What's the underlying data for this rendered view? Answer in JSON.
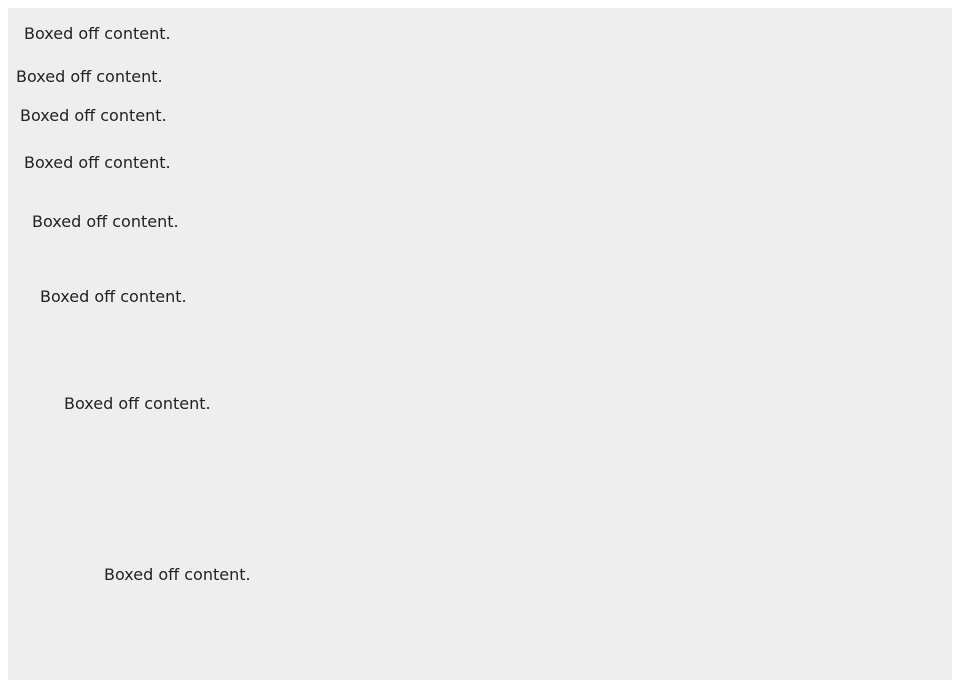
{
  "colors": {
    "panel_background": "#eeeeee",
    "text": "#222222"
  },
  "boxes": [
    {
      "text": "Boxed off content."
    },
    {
      "text": "Boxed off content."
    },
    {
      "text": "Boxed off content."
    },
    {
      "text": "Boxed off content."
    },
    {
      "text": "Boxed off content."
    },
    {
      "text": "Boxed off content."
    },
    {
      "text": "Boxed off content."
    },
    {
      "text": "Boxed off content."
    }
  ]
}
